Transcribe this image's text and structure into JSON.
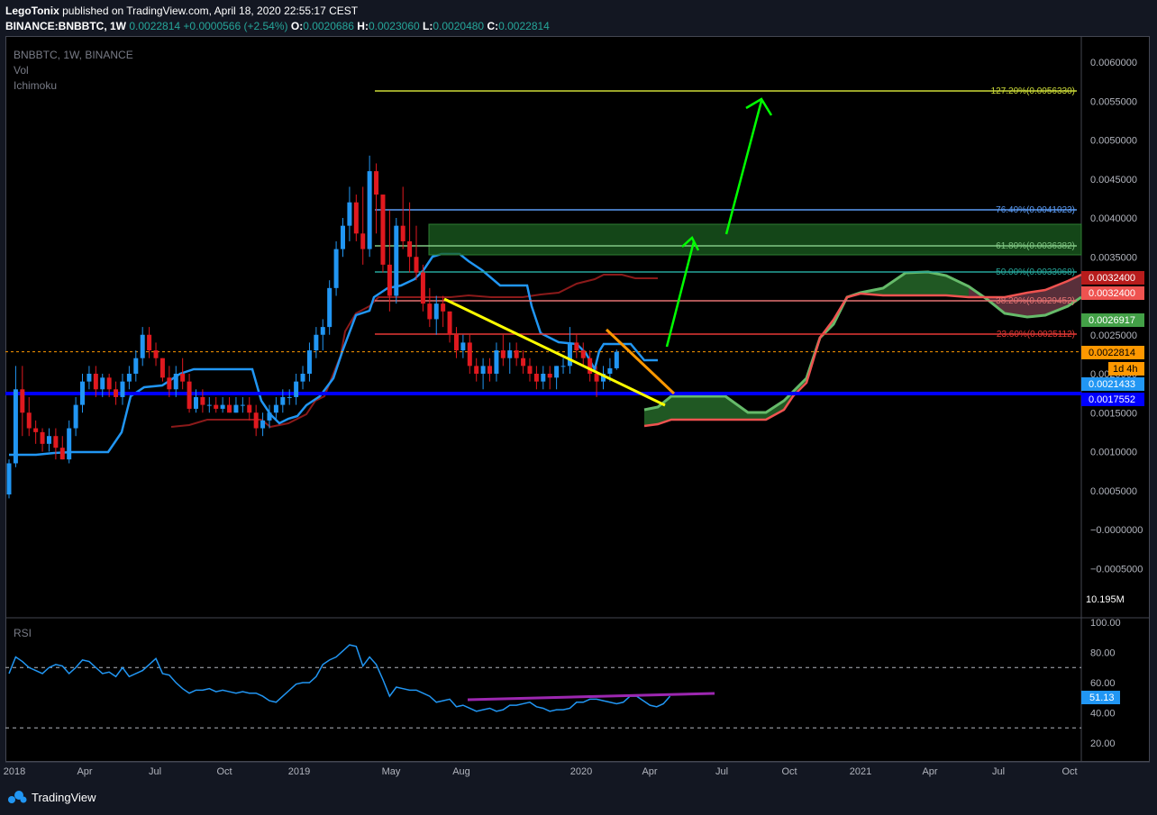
{
  "header": {
    "author": "LegoTonix",
    "published_text": "published on TradingView.com, April 18, 2020 22:55:17 CEST",
    "symbol": "BINANCE:BNBBTC, 1W",
    "last": "0.0022814",
    "change": "+0.0000566 (+2.54%)",
    "o_label": "O:",
    "o": "0.0020686",
    "h_label": "H:",
    "h": "0.0023060",
    "l_label": "L:",
    "l": "0.0020480",
    "c_label": "C:",
    "c": "0.0022814"
  },
  "legend": {
    "pair": "BNBBTC, 1W, BINANCE",
    "vol": "Vol",
    "ichimoku": "Ichimoku",
    "rsi": "RSI"
  },
  "colors": {
    "bull": "#2196f3",
    "bear": "#e0191f",
    "tenkan": "#2196f3",
    "kijun": "#8b1a1a",
    "support": "#0000ff",
    "trend_yellow": "#ffff00",
    "trend_orange": "#ff9800",
    "arrow_green": "#00ff00",
    "rsi_line": "#2196f3",
    "rsi_trend": "#9c27b0"
  },
  "chart_data": {
    "type": "candlestick",
    "symbol": "BNBBTC",
    "interval": "1W",
    "exchange": "BINANCE",
    "y_range": [
      -0.0008,
      0.0062
    ],
    "y_ticks": [
      "0.0060000",
      "0.0055000",
      "0.0050000",
      "0.0045000",
      "0.0040000",
      "0.0035000",
      "0.0030000",
      "0.0025000",
      "0.0020000",
      "0.0015000",
      "0.0010000",
      "0.0005000",
      "−0.0000000",
      "−0.0005000"
    ],
    "x_labels": [
      "2018",
      "Apr",
      "Jul",
      "Oct",
      "2019",
      "May",
      "Aug",
      "2020",
      "Apr",
      "Jul",
      "Oct",
      "2021",
      "Apr",
      "Jul",
      "Oct"
    ],
    "fib_levels": [
      {
        "label": "127.20%(0.0056330)",
        "value": 0.005633,
        "color": "#cddc39"
      },
      {
        "label": "76.40%(0.0041023)",
        "value": 0.0041023,
        "color": "#5b9cf6"
      },
      {
        "label": "61.80%(0.0036382)",
        "value": 0.0036382,
        "color": "#81c784"
      },
      {
        "label": "50.00%(0.0033068)",
        "value": 0.0033068,
        "color": "#26a69a"
      },
      {
        "label": "38.20%(0.0029452)",
        "value": 0.0029452,
        "color": "#e57373"
      },
      {
        "label": "23.60%(0.0025112)",
        "value": 0.0025112,
        "color": "#e53935"
      }
    ],
    "price_badges": [
      {
        "text": "0.0032400",
        "value": 0.00324,
        "bg": "#b71c1c",
        "fg": "#ffffff"
      },
      {
        "text": "0.0032400",
        "value": 0.003185,
        "bg": "#ef5350",
        "fg": "#ffffff"
      },
      {
        "text": "0.0026917",
        "value": 0.0026917,
        "bg": "#43a047",
        "fg": "#ffffff"
      },
      {
        "text": "0.0022814",
        "value": 0.0022814,
        "bg": "#ff9800",
        "fg": "#000000"
      },
      {
        "text": "1d 4h",
        "value": 0.00205,
        "bg": "#ff9800",
        "fg": "#000000"
      },
      {
        "text": "0.0021433",
        "value": 0.0018,
        "bg": "#2196f3",
        "fg": "#ffffff"
      },
      {
        "text": "0.0017552",
        "value": 0.0016,
        "bg": "#0000ff",
        "fg": "#ffffff"
      }
    ],
    "volume_label": "10.195M",
    "candles_ohlc": [
      [
        0.00045,
        0.0009,
        0.0004,
        0.00085
      ],
      [
        0.00085,
        0.0021,
        0.0008,
        0.0018
      ],
      [
        0.0018,
        0.0021,
        0.0012,
        0.0015
      ],
      [
        0.0015,
        0.0017,
        0.0012,
        0.0013
      ],
      [
        0.0013,
        0.0014,
        0.0011,
        0.00125
      ],
      [
        0.00125,
        0.0013,
        0.001,
        0.0011
      ],
      [
        0.0011,
        0.0013,
        0.001,
        0.0012
      ],
      [
        0.0012,
        0.0013,
        0.0009,
        0.00105
      ],
      [
        0.00105,
        0.0012,
        0.0009,
        0.0009
      ],
      [
        0.0009,
        0.0014,
        0.00085,
        0.0013
      ],
      [
        0.0013,
        0.0017,
        0.0012,
        0.0016
      ],
      [
        0.0016,
        0.002,
        0.0015,
        0.0019
      ],
      [
        0.0019,
        0.0021,
        0.0018,
        0.002
      ],
      [
        0.002,
        0.0021,
        0.0017,
        0.0018
      ],
      [
        0.0018,
        0.002,
        0.0017,
        0.00195
      ],
      [
        0.00195,
        0.002,
        0.0017,
        0.0018
      ],
      [
        0.0018,
        0.0019,
        0.0016,
        0.0017
      ],
      [
        0.0017,
        0.002,
        0.0016,
        0.0019
      ],
      [
        0.0019,
        0.0021,
        0.0018,
        0.002
      ],
      [
        0.002,
        0.0023,
        0.0019,
        0.0022
      ],
      [
        0.0022,
        0.0026,
        0.0021,
        0.0025
      ],
      [
        0.0025,
        0.0026,
        0.0022,
        0.0023
      ],
      [
        0.0023,
        0.0024,
        0.0021,
        0.0022
      ],
      [
        0.0022,
        0.0022,
        0.0019,
        0.00195
      ],
      [
        0.00195,
        0.0021,
        0.0017,
        0.0018
      ],
      [
        0.0018,
        0.0021,
        0.0017,
        0.002
      ],
      [
        0.002,
        0.0022,
        0.0018,
        0.0019
      ],
      [
        0.0019,
        0.002,
        0.0015,
        0.00155
      ],
      [
        0.00155,
        0.0018,
        0.0015,
        0.0017
      ],
      [
        0.0017,
        0.0018,
        0.0015,
        0.0016
      ],
      [
        0.0016,
        0.0017,
        0.0015,
        0.0016
      ],
      [
        0.0016,
        0.0017,
        0.0015,
        0.00155
      ],
      [
        0.00155,
        0.0017,
        0.0015,
        0.0016
      ],
      [
        0.0016,
        0.0017,
        0.0015,
        0.0015
      ],
      [
        0.0015,
        0.0017,
        0.0015,
        0.0016
      ],
      [
        0.0016,
        0.0017,
        0.0015,
        0.0016
      ],
      [
        0.0016,
        0.0017,
        0.0014,
        0.0015
      ],
      [
        0.0015,
        0.0016,
        0.0012,
        0.0013
      ],
      [
        0.0013,
        0.0015,
        0.0012,
        0.0014
      ],
      [
        0.0014,
        0.0016,
        0.0013,
        0.0015
      ],
      [
        0.0015,
        0.0017,
        0.0014,
        0.0016
      ],
      [
        0.0016,
        0.0018,
        0.0015,
        0.0017
      ],
      [
        0.0017,
        0.0018,
        0.0016,
        0.0017
      ],
      [
        0.0017,
        0.002,
        0.0016,
        0.0019
      ],
      [
        0.0019,
        0.0021,
        0.0018,
        0.002
      ],
      [
        0.002,
        0.0024,
        0.0019,
        0.0023
      ],
      [
        0.0023,
        0.0026,
        0.0022,
        0.0025
      ],
      [
        0.0025,
        0.0027,
        0.0023,
        0.0026
      ],
      [
        0.0026,
        0.0032,
        0.0025,
        0.0031
      ],
      [
        0.0031,
        0.0037,
        0.003,
        0.0036
      ],
      [
        0.0036,
        0.004,
        0.0035,
        0.0039
      ],
      [
        0.0039,
        0.0044,
        0.0037,
        0.0042
      ],
      [
        0.0042,
        0.0043,
        0.0037,
        0.0038
      ],
      [
        0.0038,
        0.0044,
        0.0034,
        0.0036
      ],
      [
        0.0036,
        0.0048,
        0.0035,
        0.0046
      ],
      [
        0.0046,
        0.0047,
        0.0038,
        0.0043
      ],
      [
        0.0043,
        0.0043,
        0.0033,
        0.0034
      ],
      [
        0.0034,
        0.0041,
        0.0028,
        0.003
      ],
      [
        0.003,
        0.004,
        0.0029,
        0.0039
      ],
      [
        0.0039,
        0.0044,
        0.0036,
        0.0037
      ],
      [
        0.0037,
        0.0042,
        0.0033,
        0.0035
      ],
      [
        0.0035,
        0.0039,
        0.0032,
        0.0033
      ],
      [
        0.0033,
        0.0034,
        0.0028,
        0.0029
      ],
      [
        0.0029,
        0.0031,
        0.0026,
        0.0027
      ],
      [
        0.0027,
        0.003,
        0.0025,
        0.0029
      ],
      [
        0.0029,
        0.003,
        0.0026,
        0.0028
      ],
      [
        0.0028,
        0.0028,
        0.0024,
        0.0025
      ],
      [
        0.0025,
        0.0026,
        0.0022,
        0.0023
      ],
      [
        0.0023,
        0.0025,
        0.0022,
        0.0024
      ],
      [
        0.0024,
        0.0025,
        0.002,
        0.0021
      ],
      [
        0.0021,
        0.0022,
        0.0019,
        0.002
      ],
      [
        0.002,
        0.0022,
        0.0018,
        0.0021
      ],
      [
        0.0021,
        0.0022,
        0.0019,
        0.002
      ],
      [
        0.002,
        0.0024,
        0.0019,
        0.0023
      ],
      [
        0.0023,
        0.0025,
        0.0021,
        0.0022
      ],
      [
        0.0022,
        0.0024,
        0.002,
        0.0023
      ],
      [
        0.0023,
        0.0024,
        0.0021,
        0.0022
      ],
      [
        0.0022,
        0.0023,
        0.002,
        0.0021
      ],
      [
        0.0021,
        0.0022,
        0.0019,
        0.002
      ],
      [
        0.002,
        0.0021,
        0.0018,
        0.0019
      ],
      [
        0.0019,
        0.0021,
        0.0018,
        0.002
      ],
      [
        0.002,
        0.0021,
        0.0018,
        0.00195
      ],
      [
        0.00195,
        0.0021,
        0.0018,
        0.0021
      ],
      [
        0.0021,
        0.0022,
        0.002,
        0.0021
      ],
      [
        0.0021,
        0.0026,
        0.002,
        0.0024
      ],
      [
        0.0024,
        0.0025,
        0.0022,
        0.0023
      ],
      [
        0.0023,
        0.0024,
        0.0021,
        0.0022
      ],
      [
        0.0022,
        0.0023,
        0.0019,
        0.002
      ],
      [
        0.002,
        0.0021,
        0.0017,
        0.0019
      ],
      [
        0.0019,
        0.0021,
        0.0018,
        0.002
      ],
      [
        0.002,
        0.0022,
        0.0019,
        0.00207
      ],
      [
        0.00207,
        0.00231,
        0.00205,
        0.0022814
      ]
    ],
    "rsi": {
      "y_ticks": [
        "100.00",
        "80.00",
        "60.00",
        "40.00",
        "20.00"
      ],
      "value_label": "51.13",
      "levels": [
        70,
        30
      ],
      "values": [
        66,
        77,
        74,
        70,
        68,
        66,
        70,
        72,
        71,
        66,
        70,
        75,
        74,
        70,
        66,
        67,
        64,
        70,
        64,
        66,
        68,
        72,
        76,
        66,
        65,
        60,
        56,
        53,
        55,
        55,
        56,
        54,
        55,
        54,
        53,
        54,
        53,
        53,
        51,
        48,
        47,
        51,
        55,
        59,
        60,
        60,
        64,
        72,
        75,
        77,
        81,
        85,
        84,
        71,
        77,
        72,
        62,
        51,
        57,
        56,
        55,
        55,
        53,
        51,
        47,
        48,
        49,
        44,
        45,
        43,
        41,
        42,
        43,
        41,
        42,
        45,
        45,
        46,
        47,
        44,
        43,
        41,
        42,
        42,
        43,
        47,
        47,
        49,
        49,
        48,
        47,
        46,
        47,
        51,
        51,
        48,
        45,
        44,
        46,
        51
      ]
    }
  }
}
